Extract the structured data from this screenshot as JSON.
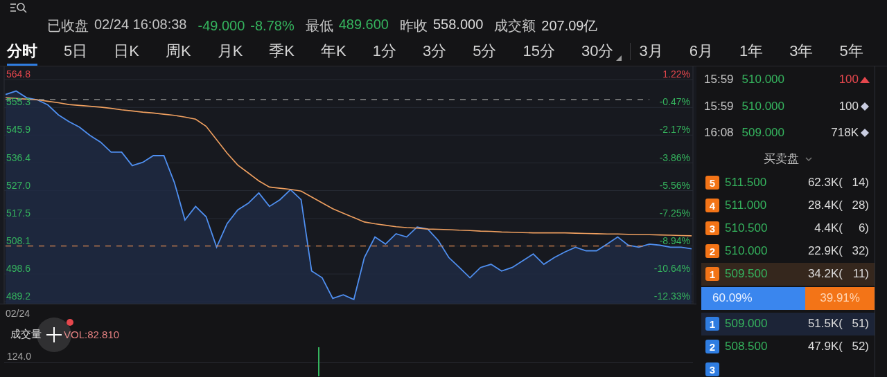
{
  "header": {
    "status": "已收盘",
    "datetime": "02/24 16:08:38",
    "change": {
      "amount": "-49.000",
      "percent": "-8.78%",
      "color": "#35b45e"
    },
    "stats": [
      {
        "label": "最低",
        "value": "489.600",
        "color": "#35b45e"
      },
      {
        "label": "昨收",
        "value": "558.000",
        "color": "#dcdcdc"
      },
      {
        "label": "成交额",
        "value": "207.09亿",
        "color": "#dcdcdc"
      }
    ]
  },
  "tabs": {
    "periods": [
      {
        "label": "分时",
        "selected": true,
        "menu": false
      },
      {
        "label": "5日",
        "selected": false,
        "menu": false
      },
      {
        "label": "日K",
        "selected": false,
        "menu": false
      },
      {
        "label": "周K",
        "selected": false,
        "menu": false
      },
      {
        "label": "月K",
        "selected": false,
        "menu": false
      },
      {
        "label": "季K",
        "selected": false,
        "menu": false
      },
      {
        "label": "年K",
        "selected": false,
        "menu": false
      },
      {
        "label": "1分",
        "selected": false,
        "menu": false
      },
      {
        "label": "3分",
        "selected": false,
        "menu": false
      },
      {
        "label": "5分",
        "selected": false,
        "menu": false
      },
      {
        "label": "15分",
        "selected": false,
        "menu": false
      },
      {
        "label": "30分",
        "selected": false,
        "menu": true
      }
    ],
    "ranges": [
      {
        "label": "3月",
        "selected": false
      },
      {
        "label": "6月",
        "selected": false
      },
      {
        "label": "1年",
        "selected": false
      },
      {
        "label": "3年",
        "selected": false
      },
      {
        "label": "5年",
        "selected": false
      }
    ]
  },
  "chart": {
    "percent_labels": [
      {
        "text": "1.22%",
        "color": "#e5474d"
      },
      {
        "text": "-0.47%",
        "color": "#35b45e"
      },
      {
        "text": "-2.17%",
        "color": "#35b45e"
      },
      {
        "text": "-3.86%",
        "color": "#35b45e"
      },
      {
        "text": "-5.56%",
        "color": "#35b45e"
      },
      {
        "text": "-7.25%",
        "color": "#35b45e"
      },
      {
        "text": "-8.94%",
        "color": "#35b45e"
      },
      {
        "text": "-10.64%",
        "color": "#35b45e"
      },
      {
        "text": "-12.33%",
        "color": "#35b45e"
      }
    ],
    "chart_data": {
      "type": "line",
      "ylim": [
        489.2,
        564.8
      ],
      "yticks": [
        {
          "value": 564.8,
          "label": "564.8"
        },
        {
          "value": 555.3,
          "label": "555.3"
        },
        {
          "value": 545.9,
          "label": "545.9"
        },
        {
          "value": 536.4,
          "label": "536.4"
        },
        {
          "value": 527.0,
          "label": "527.0"
        },
        {
          "value": 517.5,
          "label": "517.5"
        },
        {
          "value": 508.1,
          "label": "508.1"
        },
        {
          "value": 498.6,
          "label": "498.6"
        },
        {
          "value": 489.2,
          "label": "489.2"
        }
      ],
      "series": [
        {
          "color": "#4f8ff0",
          "line_style": "solid",
          "values": [
            559.7,
            560.9,
            558.6,
            557.9,
            556.2,
            552.8,
            550.5,
            548.6,
            545.8,
            543.5,
            540.1,
            540.1,
            535.5,
            536.6,
            538.9,
            538.9,
            529.7,
            517.0,
            521.6,
            518.1,
            507.7,
            515.8,
            520.4,
            522.7,
            526.2,
            521.6,
            523.9,
            527.3,
            523.9,
            499.6,
            497.3,
            490.3,
            491.5,
            489.9,
            504.2,
            511.2,
            508.8,
            512.3,
            511.2,
            514.6,
            513.9,
            510.0,
            504.2,
            500.8,
            497.3,
            500.8,
            501.9,
            499.6,
            500.8,
            503.1,
            505.4,
            501.9,
            504.2,
            506.1,
            507.7,
            506.5,
            506.5,
            508.8,
            511.2,
            508.4,
            507.7,
            508.8,
            508.4,
            507.7,
            507.7,
            507.2
          ]
        },
        {
          "color": "#f0a060",
          "line_style": "solid",
          "values": [
            558.6,
            558.4,
            558.1,
            557.9,
            557.4,
            556.9,
            556.3,
            556.0,
            555.7,
            555.4,
            555.0,
            554.5,
            554.1,
            553.7,
            553.4,
            553.0,
            552.6,
            552.0,
            551.3,
            548.9,
            544.3,
            539.7,
            535.7,
            533.0,
            530.3,
            528.2,
            527.8,
            527.4,
            526.8,
            524.8,
            522.8,
            520.8,
            519.3,
            517.8,
            516.3,
            515.7,
            515.2,
            514.7,
            514.4,
            514.2,
            513.9,
            513.8,
            513.7,
            513.5,
            513.4,
            513.2,
            513.1,
            512.9,
            512.8,
            512.7,
            512.6,
            512.6,
            512.6,
            512.6,
            512.5,
            512.4,
            512.3,
            512.2,
            512.2,
            512.1,
            512.0,
            512.0,
            511.9,
            511.8,
            511.7,
            511.6
          ]
        },
        {
          "color": "#9a9a9a",
          "line_style": "dashed",
          "values": [
            558.0,
            558.0,
            558.0,
            558.0,
            558.0,
            558.0,
            558.0,
            558.0,
            558.0,
            558.0,
            558.0,
            558.0,
            558.0,
            558.0,
            558.0,
            558.0,
            558.0,
            558.0,
            558.0,
            558.0,
            558.0,
            558.0,
            558.0,
            558.0,
            558.0,
            558.0,
            558.0,
            558.0,
            558.0,
            558.0,
            558.0,
            558.0,
            558.0,
            558.0,
            558.0,
            558.0,
            558.0,
            558.0,
            558.0,
            558.0,
            558.0,
            558.0,
            558.0,
            558.0,
            558.0,
            558.0,
            558.0,
            558.0,
            558.0,
            558.0,
            558.0,
            558.0,
            558.0,
            558.0,
            558.0,
            558.0,
            558.0,
            558.0,
            558.0,
            558.0,
            558.0,
            558.0,
            null,
            null,
            null,
            null
          ]
        },
        {
          "color": "#e08a50",
          "line_style": "dashed",
          "values": [
            508.1,
            508.1,
            508.1,
            508.1,
            508.1,
            508.1,
            508.1,
            508.1,
            508.1,
            508.1,
            508.1,
            508.1,
            508.1,
            508.1,
            508.1,
            508.1,
            508.1,
            508.1,
            508.1,
            508.1,
            508.1,
            508.1,
            508.1,
            508.1,
            508.1,
            508.1,
            508.1,
            508.1,
            508.1,
            508.1,
            508.1,
            508.1,
            508.1,
            508.1,
            508.1,
            508.1,
            508.1,
            508.1,
            508.1,
            508.1,
            508.1,
            508.1,
            508.1,
            508.1,
            508.1,
            508.1,
            508.1,
            508.1,
            508.1,
            508.1,
            508.1,
            508.1,
            508.1,
            508.1,
            508.1,
            508.1,
            508.1,
            508.1,
            508.1,
            508.1,
            508.1,
            508.1,
            null,
            null,
            null,
            null
          ]
        }
      ],
      "grid": true
    }
  },
  "volume": {
    "date": "02/24",
    "label": "成交量",
    "indicator": "VOL:82.810",
    "scale_label": "124.0"
  },
  "trades": [
    {
      "time": "15:59",
      "price": "510.000",
      "size": "100",
      "kind": "up"
    },
    {
      "time": "15:59",
      "price": "510.000",
      "size": "100",
      "kind": "neutral"
    },
    {
      "time": "16:08",
      "price": "509.000",
      "size": "718K",
      "kind": "neutral"
    }
  ],
  "order_book": {
    "title": "买卖盘",
    "asks": [
      {
        "level": "5",
        "price": "511.500",
        "volume": "62.3K(",
        "count": "14)",
        "highlighted": false
      },
      {
        "level": "4",
        "price": "511.000",
        "volume": "28.4K(",
        "count": "28)",
        "highlighted": false
      },
      {
        "level": "3",
        "price": "510.500",
        "volume": "4.4K(",
        "count": "6)",
        "highlighted": false
      },
      {
        "level": "2",
        "price": "510.000",
        "volume": "22.9K(",
        "count": "32)",
        "highlighted": false
      },
      {
        "level": "1",
        "price": "509.500",
        "volume": "34.2K(",
        "count": "11)",
        "highlighted": true
      }
    ],
    "ratio": {
      "bid": "60.09%",
      "ask": "39.91%",
      "level": 0.6009
    },
    "bids": [
      {
        "level": "1",
        "price": "509.000",
        "volume": "51.5K(",
        "count": "51)",
        "highlighted": true
      },
      {
        "level": "2",
        "price": "508.500",
        "volume": "47.9K(",
        "count": "52)",
        "highlighted": false
      },
      {
        "level": "3",
        "highlighted": false
      }
    ]
  }
}
